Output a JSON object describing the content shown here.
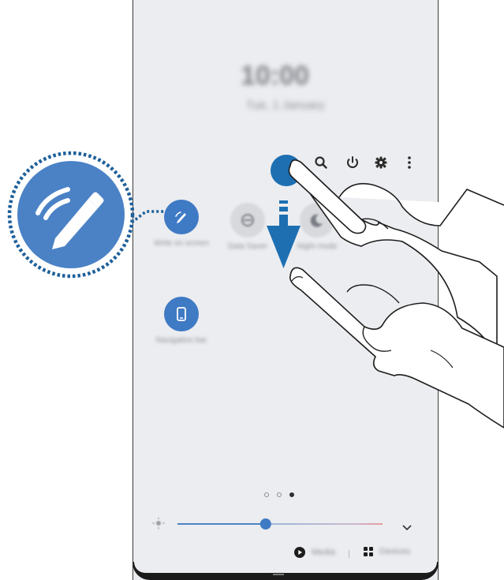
{
  "screen": {
    "clock": "10:00",
    "date": "Tue, 1 January",
    "quick_panel_actions": [
      {
        "name": "search-icon"
      },
      {
        "name": "power-icon"
      },
      {
        "name": "gear-icon"
      },
      {
        "name": "more-options-icon"
      }
    ],
    "tiles": [
      {
        "name": "tile-write-on-screen",
        "label": "Write on screen",
        "icon": "pen-icon",
        "state": "on"
      },
      {
        "name": "tile-data-saver",
        "label": "Data Saver",
        "icon": "data-saver-icon",
        "state": "off"
      },
      {
        "name": "tile-night-mode",
        "label": "Night mode",
        "icon": "moon-icon",
        "state": "off"
      },
      {
        "name": "tile-navigation-bar",
        "label": "Navigation bar",
        "icon": "navigation-bar-icon",
        "state": "on"
      }
    ],
    "page_indicator": {
      "pages": 3,
      "current": 3
    },
    "brightness": {
      "level": 0.43,
      "icon": "sun-icon"
    },
    "media_button": {
      "label": "Media",
      "icon": "play-icon"
    },
    "devices_button": {
      "label": "Devices",
      "icon": "grid-icon"
    }
  },
  "colors": {
    "accent": "#3f7ac4",
    "callout_blue": "#4b82c6",
    "callout_border": "#1d5f9a",
    "panel_bg": "#ecedf0",
    "arrow": "#1f6fb2"
  },
  "annotation": {
    "gesture": "swipe-down",
    "callout_icon": "pen-icon"
  }
}
